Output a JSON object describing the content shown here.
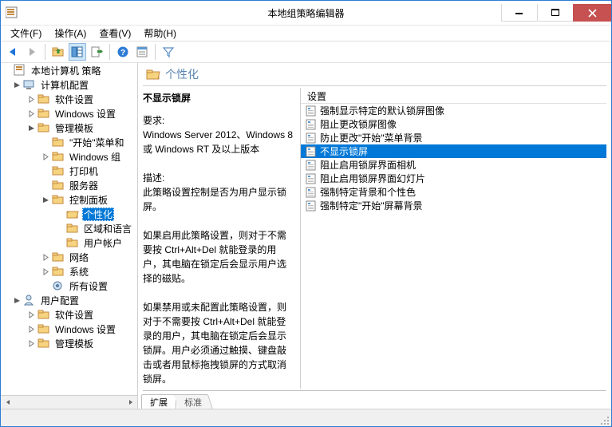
{
  "titlebar": {
    "title": "本地组策略编辑器"
  },
  "menubar": {
    "file": "文件(F)",
    "action": "操作(A)",
    "view": "查看(V)",
    "help": "帮助(H)"
  },
  "tree": {
    "root": "本地计算机 策略",
    "computer_config": "计算机配置",
    "software_settings": "软件设置",
    "windows_settings": "Windows 设置",
    "admin_templates": "管理模板",
    "start_menu": "\"开始\"菜单和",
    "windows_components": "Windows 组",
    "printers": "打印机",
    "server": "服务器",
    "control_panel": "控制面板",
    "personalization": "个性化",
    "region_lang": "区域和语言",
    "user_accounts": "用户帐户",
    "network": "网络",
    "system": "系统",
    "all_settings": "所有设置",
    "user_config": "用户配置",
    "u_software_settings": "软件设置",
    "u_windows_settings": "Windows 设置",
    "u_admin_templates": "管理模板"
  },
  "detail": {
    "breadcrumb": "个性化",
    "col_header": "设置",
    "explain_title": "不显示锁屏",
    "req_label": "要求:",
    "req_body": "Windows Server 2012、Windows 8 或 Windows RT 及以上版本",
    "desc_label": "描述:",
    "desc_body1": "此策略设置控制是否为用户显示锁屏。",
    "desc_body2": "如果启用此策略设置，则对于不需要按 Ctrl+Alt+Del 就能登录的用户，其电脑在锁定后会显示用户选择的磁贴。",
    "desc_body3": "如果禁用或未配置此策略设置，则对于不需要按 Ctrl+Alt+Del 就能登录的用户，其电脑在锁定后会显示锁屏。用户必须通过触摸、键盘敲击或者用鼠标拖拽锁屏的方式取消锁屏。",
    "items": [
      "强制显示特定的默认锁屏图像",
      "阻止更改锁屏图像",
      "防止更改\"开始\"菜单背景",
      "不显示锁屏",
      "阻止启用锁屏界面相机",
      "阻止启用锁屏界面幻灯片",
      "强制特定背景和个性色",
      "强制特定\"开始\"屏幕背景"
    ],
    "selected_index": 3,
    "tab_ext": "扩展",
    "tab_std": "标准"
  }
}
